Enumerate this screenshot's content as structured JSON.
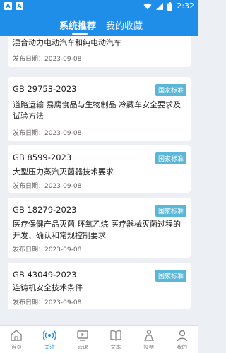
{
  "status_bar": {
    "time": "2:32",
    "left_icons": [
      "A-notification-icon",
      "A-notification-icon"
    ]
  },
  "header": {
    "tabs": [
      {
        "label": "系统推荐",
        "active": true
      },
      {
        "label": "我的收藏",
        "active": false
      }
    ]
  },
  "cards": [
    {
      "code": "",
      "badge": "",
      "title": "混合动力电动汽车和纯电动汽车",
      "date_label": "发布日期：2023-09-08"
    },
    {
      "code": "GB 29753-2023",
      "badge": "国家标准",
      "title": "道路运输 易腐食品与生物制品 冷藏车安全要求及试验方法",
      "date_label": "发布日期：2023-09-08"
    },
    {
      "code": "GB 8599-2023",
      "badge": "国家标准",
      "title": "大型压力蒸汽灭菌器技术要求",
      "date_label": "发布日期：2023-09-08"
    },
    {
      "code": "GB 18279-2023",
      "badge": "国家标准",
      "title": "医疗保健产品灭菌 环氧乙烷 医疗器械灭菌过程的开发、确认和常规控制要求",
      "date_label": "发布日期：2023-09-08"
    },
    {
      "code": "GB 43049-2023",
      "badge": "国家标准",
      "title": "连铸机安全技术条件",
      "date_label": "发布日期：2023-09-08"
    }
  ],
  "bottom_nav": [
    {
      "label": "首页",
      "icon": "home-icon",
      "active": false
    },
    {
      "label": "关注",
      "icon": "broadcast-icon",
      "active": true
    },
    {
      "label": "云课",
      "icon": "video-icon",
      "active": false
    },
    {
      "label": "文本",
      "icon": "book-icon",
      "active": false
    },
    {
      "label": "投票",
      "icon": "people-icon",
      "active": false
    },
    {
      "label": "我的",
      "icon": "user-icon",
      "active": false
    }
  ],
  "colors": {
    "primary": "#1f8ee9",
    "badge": "#5bb7d8",
    "background": "#eceff3"
  }
}
